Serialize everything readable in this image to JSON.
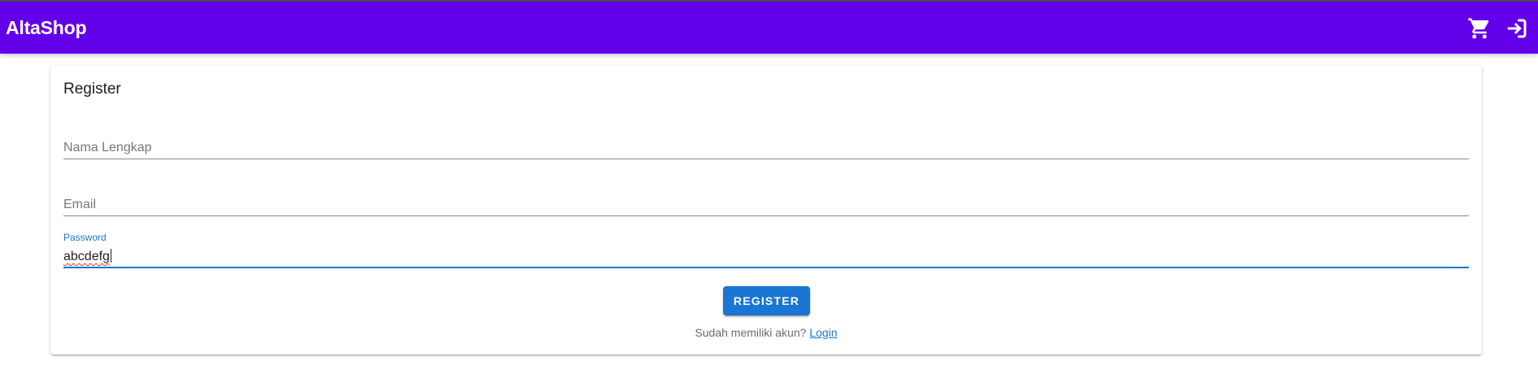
{
  "app": {
    "brand": "AltaShop",
    "brand_color": "#6200ea",
    "icons": [
      "cart-icon",
      "login-icon"
    ]
  },
  "register": {
    "title": "Register",
    "fields": {
      "name_placeholder": "Nama Lengkap",
      "email_placeholder": "Email",
      "password_label": "Password",
      "password_value": "abcdefg"
    },
    "submit_label": "REGISTER",
    "accent_color": "#1976d2",
    "footer_prompt": "Sudah memiliki akun?",
    "login_link": "Login"
  }
}
